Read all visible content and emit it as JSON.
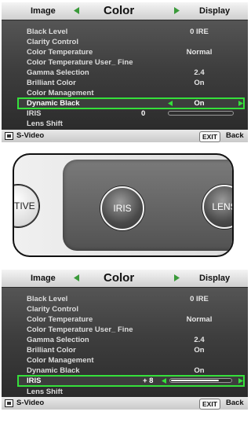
{
  "top_osd": {
    "tabs": {
      "left": "Image",
      "center": "Color",
      "right": "Display"
    },
    "rows": [
      {
        "label": "Black Level",
        "value": "0 IRE"
      },
      {
        "label": "Clarity Control",
        "value": ""
      },
      {
        "label": "Color Temperature",
        "value": "Normal"
      },
      {
        "label": "Color Temperature User_ Fine",
        "value": ""
      },
      {
        "label": "Gamma Selection",
        "value": "2.4"
      },
      {
        "label": "Brilliant Color",
        "value": "On"
      },
      {
        "label": "Color Management",
        "value": ""
      },
      {
        "label": "Dynamic Black",
        "value": "On"
      },
      {
        "label": "IRIS",
        "value": "0"
      },
      {
        "label": "Lens Shift",
        "value": ""
      }
    ],
    "iris_level": 0,
    "footer": {
      "source": "S-Video",
      "exit_key": "EXIT",
      "exit_label": "Back"
    }
  },
  "remote": {
    "buttons": {
      "left": "ACTIVE",
      "center": "IRIS",
      "right": "LENS"
    }
  },
  "bottom_osd": {
    "tabs": {
      "left": "Image",
      "center": "Color",
      "right": "Display"
    },
    "rows": [
      {
        "label": "Black Level",
        "value": "0 IRE"
      },
      {
        "label": "Clarity Control",
        "value": ""
      },
      {
        "label": "Color Temperature",
        "value": "Normal"
      },
      {
        "label": "Color Temperature User_ Fine",
        "value": ""
      },
      {
        "label": "Gamma Selection",
        "value": "2.4"
      },
      {
        "label": "Brilliant Color",
        "value": "On"
      },
      {
        "label": "Color Management",
        "value": ""
      },
      {
        "label": "Dynamic Black",
        "value": "On"
      },
      {
        "label": "IRIS",
        "value": "+ 8"
      },
      {
        "label": "Lens Shift",
        "value": ""
      }
    ],
    "iris_level": 0.8,
    "footer": {
      "source": "S-Video",
      "exit_key": "EXIT",
      "exit_label": "Back"
    }
  },
  "colors": {
    "highlight": "#35e03b",
    "arrow": "#35e03b"
  },
  "icons": {
    "tab_marker": "triangle-icon",
    "source": "input-source-icon"
  }
}
